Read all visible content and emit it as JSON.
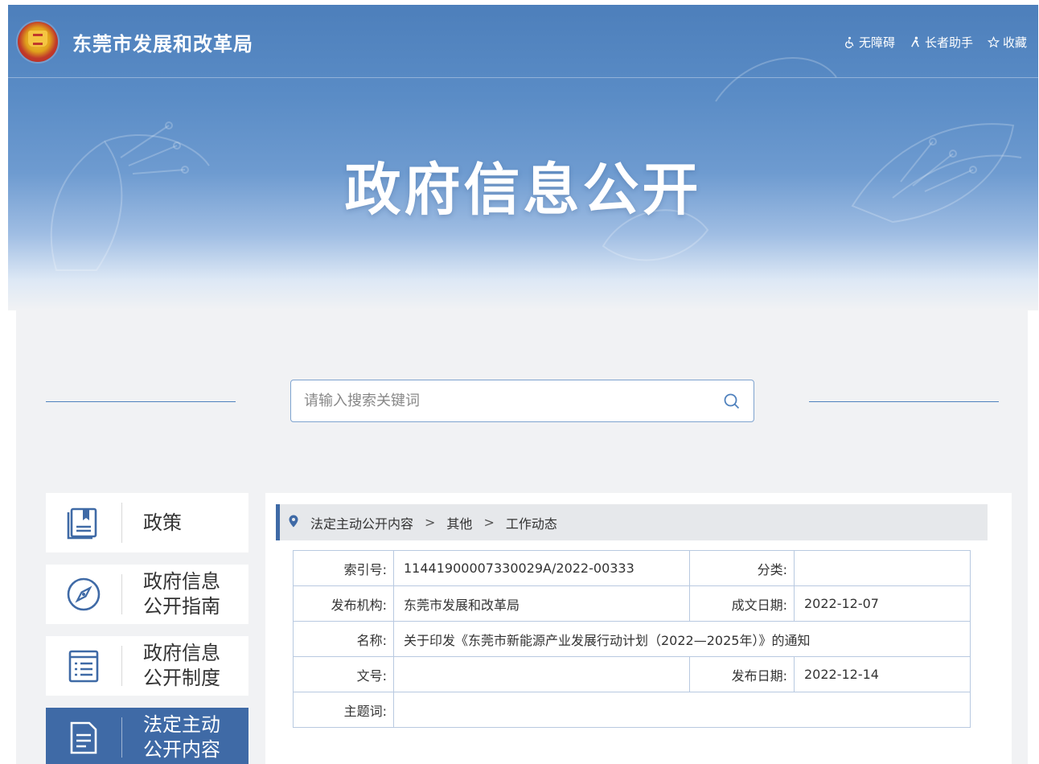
{
  "header": {
    "site_title": "东莞市发展和改革局",
    "links": [
      {
        "label": "无障碍",
        "icon": "accessibility-icon"
      },
      {
        "label": "长者助手",
        "icon": "elder-helper-icon"
      },
      {
        "label": "收藏",
        "icon": "star-icon"
      }
    ]
  },
  "hero": {
    "title": "政府信息公开"
  },
  "search": {
    "placeholder": "请输入搜索关键词",
    "icon": "search-icon"
  },
  "menu": {
    "items": [
      {
        "label": "政策",
        "icon": "book-icon",
        "active": false
      },
      {
        "label": "政府信息公开指南",
        "line1": "政府信息",
        "line2": "公开指南",
        "icon": "compass-icon",
        "active": false
      },
      {
        "label": "政府信息公开制度",
        "line1": "政府信息",
        "line2": "公开制度",
        "icon": "list-icon",
        "active": false
      },
      {
        "label": "法定主动公开内容",
        "line1": "法定主动",
        "line2": "公开内容",
        "icon": "document-icon",
        "active": true
      }
    ]
  },
  "breadcrumb": {
    "icon": "location-pin-icon",
    "items": [
      "法定主动公开内容",
      "其他",
      "工作动态"
    ],
    "separator": ">"
  },
  "info": {
    "index_no": {
      "label": "索引号:",
      "value": "11441900007330029A/2022-00333"
    },
    "category": {
      "label": "分类:",
      "value": ""
    },
    "publisher": {
      "label": "发布机构:",
      "value": "东莞市发展和改革局"
    },
    "doc_date": {
      "label": "成文日期:",
      "value": "2022-12-07"
    },
    "name": {
      "label": "名称:",
      "value": "关于印发《东莞市新能源产业发展行动计划（2022—2025年）》的通知"
    },
    "doc_no": {
      "label": "文号:",
      "value": ""
    },
    "publish_date": {
      "label": "发布日期:",
      "value": "2022-12-14"
    },
    "keywords": {
      "label": "主题词:",
      "value": ""
    }
  },
  "colors": {
    "primary": "#3f6aa6",
    "banner_top": "#4d7fbb",
    "content_bg": "#f1f2f4"
  }
}
